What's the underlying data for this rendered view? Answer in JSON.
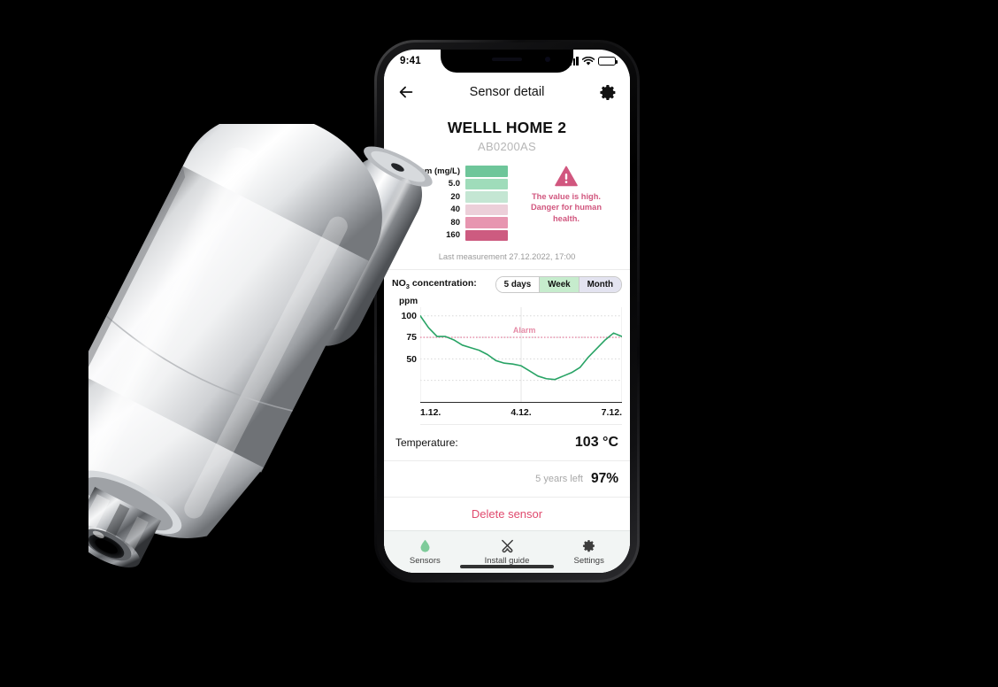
{
  "background_color": "#000000",
  "phone": {
    "status_bar": {
      "time": "9:41",
      "signal_icon": "cellular-signal-icon",
      "wifi_icon": "wifi-icon",
      "battery_icon": "battery-icon"
    },
    "navbar": {
      "back_icon": "back-arrow-icon",
      "title": "Sensor detail",
      "settings_icon": "gear-icon"
    },
    "device": {
      "name": "WELLL HOME 2",
      "id": "AB0200AS"
    },
    "scale": {
      "rows": [
        {
          "label": "0 ppm (mg/L)",
          "color": "#6ec69a"
        },
        {
          "label": "5.0",
          "color": "#9fdcba"
        },
        {
          "label": "20",
          "color": "#c4e6d3"
        },
        {
          "label": "40",
          "color": "#eccfd9"
        },
        {
          "label": "80",
          "color": "#e795b0"
        },
        {
          "label": "160",
          "color": "#cd5b80"
        }
      ]
    },
    "warning": {
      "icon": "warning-triangle-icon",
      "color": "#d1577f",
      "line1": "The value is high.",
      "line2": "Danger for human",
      "line3": "health."
    },
    "last_measurement": "Last measurement 27.12.2022, 17:00",
    "chart_header": {
      "label_prefix": "NO",
      "label_sub": "3",
      "label_suffix": " concentration:",
      "segments": [
        {
          "label": "5 days",
          "selected": true,
          "bg": "#ffffff"
        },
        {
          "label": "Week",
          "selected": false,
          "bg": "#c6eccd"
        },
        {
          "label": "Month",
          "selected": false,
          "bg": "#e3e3f0"
        }
      ]
    },
    "temperature": {
      "label": "Temperature:",
      "value": "103 °C"
    },
    "battery": {
      "sub": "5 years left",
      "value": "97%"
    },
    "delete": {
      "label": "Delete sensor",
      "color": "#e04a6e"
    },
    "tabbar": {
      "tabs": [
        {
          "label": "Sensors",
          "icon": "sensor-drop-icon",
          "active": true,
          "color": "#7ecb9a"
        },
        {
          "label": "Install guide",
          "icon": "tools-icon",
          "active": false,
          "color": "#3d3d3d"
        },
        {
          "label": "Settings",
          "icon": "gear-icon",
          "active": false,
          "color": "#3d3d3d"
        }
      ]
    }
  },
  "chart_data": {
    "type": "line",
    "title": "NO3 concentration:",
    "xlabel": "",
    "ylabel": "ppm",
    "ylim": [
      0,
      110
    ],
    "yticks": [
      100,
      75,
      50
    ],
    "ytick_labels": [
      "100",
      "75",
      "50"
    ],
    "xticks": [
      "1.12.",
      "4.12.",
      "7.12."
    ],
    "grid": true,
    "line_color": "#28a365",
    "alarm": {
      "label": "Alarm",
      "value": 75,
      "color": "#e58aa6"
    },
    "x": [
      0,
      1,
      2,
      3,
      4,
      5,
      6,
      7,
      8,
      9,
      10,
      11,
      12,
      13,
      14,
      15,
      16,
      17,
      18,
      19,
      20,
      21,
      22,
      23,
      24
    ],
    "values": [
      100,
      86,
      76,
      76,
      72,
      66,
      63,
      60,
      55,
      48,
      45,
      44,
      42,
      36,
      30,
      27,
      26,
      30,
      34,
      40,
      52,
      62,
      72,
      80,
      76
    ]
  }
}
